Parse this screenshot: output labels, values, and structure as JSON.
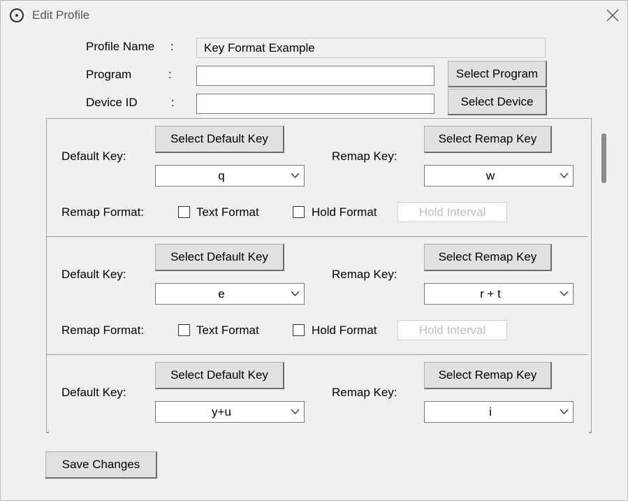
{
  "window": {
    "title": "Edit Profile"
  },
  "form": {
    "profile_name_label": "Profile Name",
    "program_label": "Program",
    "device_id_label": "Device ID",
    "colon": ":",
    "profile_name_value": "Key Format Example",
    "program_value": "",
    "device_id_value": "",
    "select_program_label": "Select Program",
    "select_device_label": "Select Device"
  },
  "mappings": [
    {
      "default_key_label": "Default Key:",
      "select_default_key_label": "Select Default Key",
      "default_key_value": "q",
      "remap_key_label": "Remap Key:",
      "select_remap_key_label": "Select Remap Key",
      "remap_key_value": "w",
      "remap_format_label": "Remap Format:",
      "text_format_label": "Text Format",
      "text_format_checked": false,
      "hold_format_label": "Hold Format",
      "hold_format_checked": false,
      "hold_interval_placeholder": "Hold Interval"
    },
    {
      "default_key_label": "Default Key:",
      "select_default_key_label": "Select Default Key",
      "default_key_value": "e",
      "remap_key_label": "Remap Key:",
      "select_remap_key_label": "Select Remap Key",
      "remap_key_value": "r + t",
      "remap_format_label": "Remap Format:",
      "text_format_label": "Text Format",
      "text_format_checked": false,
      "hold_format_label": "Hold Format",
      "hold_format_checked": false,
      "hold_interval_placeholder": "Hold Interval"
    },
    {
      "default_key_label": "Default Key:",
      "select_default_key_label": "Select Default Key",
      "default_key_value": "y+u",
      "remap_key_label": "Remap Key:",
      "select_remap_key_label": "Select Remap Key",
      "remap_key_value": "i"
    }
  ],
  "footer": {
    "save_changes_label": "Save Changes"
  }
}
